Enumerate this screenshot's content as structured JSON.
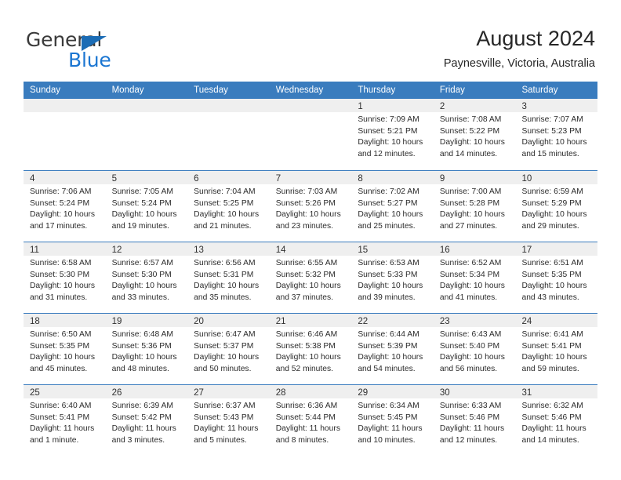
{
  "branding": {
    "name_dark": "General",
    "name_blue": "Blue",
    "triangle_color": "#1b6cb5",
    "blue_color": "#1b76d2"
  },
  "header": {
    "title": "August 2024",
    "subtitle": "Paynesville, Victoria, Australia"
  },
  "theme": {
    "header_bar_color": "#3a7cbe",
    "day_band_color": "#efefef",
    "text_color": "#2b2b2b"
  },
  "weekdays": [
    "Sunday",
    "Monday",
    "Tuesday",
    "Wednesday",
    "Thursday",
    "Friday",
    "Saturday"
  ],
  "weeks": [
    [
      {
        "day": "",
        "empty": true
      },
      {
        "day": "",
        "empty": true
      },
      {
        "day": "",
        "empty": true
      },
      {
        "day": "",
        "empty": true
      },
      {
        "day": "1",
        "sunrise": "Sunrise: 7:09 AM",
        "sunset": "Sunset: 5:21 PM",
        "daylight1": "Daylight: 10 hours",
        "daylight2": "and 12 minutes."
      },
      {
        "day": "2",
        "sunrise": "Sunrise: 7:08 AM",
        "sunset": "Sunset: 5:22 PM",
        "daylight1": "Daylight: 10 hours",
        "daylight2": "and 14 minutes."
      },
      {
        "day": "3",
        "sunrise": "Sunrise: 7:07 AM",
        "sunset": "Sunset: 5:23 PM",
        "daylight1": "Daylight: 10 hours",
        "daylight2": "and 15 minutes."
      }
    ],
    [
      {
        "day": "4",
        "sunrise": "Sunrise: 7:06 AM",
        "sunset": "Sunset: 5:24 PM",
        "daylight1": "Daylight: 10 hours",
        "daylight2": "and 17 minutes."
      },
      {
        "day": "5",
        "sunrise": "Sunrise: 7:05 AM",
        "sunset": "Sunset: 5:24 PM",
        "daylight1": "Daylight: 10 hours",
        "daylight2": "and 19 minutes."
      },
      {
        "day": "6",
        "sunrise": "Sunrise: 7:04 AM",
        "sunset": "Sunset: 5:25 PM",
        "daylight1": "Daylight: 10 hours",
        "daylight2": "and 21 minutes."
      },
      {
        "day": "7",
        "sunrise": "Sunrise: 7:03 AM",
        "sunset": "Sunset: 5:26 PM",
        "daylight1": "Daylight: 10 hours",
        "daylight2": "and 23 minutes."
      },
      {
        "day": "8",
        "sunrise": "Sunrise: 7:02 AM",
        "sunset": "Sunset: 5:27 PM",
        "daylight1": "Daylight: 10 hours",
        "daylight2": "and 25 minutes."
      },
      {
        "day": "9",
        "sunrise": "Sunrise: 7:00 AM",
        "sunset": "Sunset: 5:28 PM",
        "daylight1": "Daylight: 10 hours",
        "daylight2": "and 27 minutes."
      },
      {
        "day": "10",
        "sunrise": "Sunrise: 6:59 AM",
        "sunset": "Sunset: 5:29 PM",
        "daylight1": "Daylight: 10 hours",
        "daylight2": "and 29 minutes."
      }
    ],
    [
      {
        "day": "11",
        "sunrise": "Sunrise: 6:58 AM",
        "sunset": "Sunset: 5:30 PM",
        "daylight1": "Daylight: 10 hours",
        "daylight2": "and 31 minutes."
      },
      {
        "day": "12",
        "sunrise": "Sunrise: 6:57 AM",
        "sunset": "Sunset: 5:30 PM",
        "daylight1": "Daylight: 10 hours",
        "daylight2": "and 33 minutes."
      },
      {
        "day": "13",
        "sunrise": "Sunrise: 6:56 AM",
        "sunset": "Sunset: 5:31 PM",
        "daylight1": "Daylight: 10 hours",
        "daylight2": "and 35 minutes."
      },
      {
        "day": "14",
        "sunrise": "Sunrise: 6:55 AM",
        "sunset": "Sunset: 5:32 PM",
        "daylight1": "Daylight: 10 hours",
        "daylight2": "and 37 minutes."
      },
      {
        "day": "15",
        "sunrise": "Sunrise: 6:53 AM",
        "sunset": "Sunset: 5:33 PM",
        "daylight1": "Daylight: 10 hours",
        "daylight2": "and 39 minutes."
      },
      {
        "day": "16",
        "sunrise": "Sunrise: 6:52 AM",
        "sunset": "Sunset: 5:34 PM",
        "daylight1": "Daylight: 10 hours",
        "daylight2": "and 41 minutes."
      },
      {
        "day": "17",
        "sunrise": "Sunrise: 6:51 AM",
        "sunset": "Sunset: 5:35 PM",
        "daylight1": "Daylight: 10 hours",
        "daylight2": "and 43 minutes."
      }
    ],
    [
      {
        "day": "18",
        "sunrise": "Sunrise: 6:50 AM",
        "sunset": "Sunset: 5:35 PM",
        "daylight1": "Daylight: 10 hours",
        "daylight2": "and 45 minutes."
      },
      {
        "day": "19",
        "sunrise": "Sunrise: 6:48 AM",
        "sunset": "Sunset: 5:36 PM",
        "daylight1": "Daylight: 10 hours",
        "daylight2": "and 48 minutes."
      },
      {
        "day": "20",
        "sunrise": "Sunrise: 6:47 AM",
        "sunset": "Sunset: 5:37 PM",
        "daylight1": "Daylight: 10 hours",
        "daylight2": "and 50 minutes."
      },
      {
        "day": "21",
        "sunrise": "Sunrise: 6:46 AM",
        "sunset": "Sunset: 5:38 PM",
        "daylight1": "Daylight: 10 hours",
        "daylight2": "and 52 minutes."
      },
      {
        "day": "22",
        "sunrise": "Sunrise: 6:44 AM",
        "sunset": "Sunset: 5:39 PM",
        "daylight1": "Daylight: 10 hours",
        "daylight2": "and 54 minutes."
      },
      {
        "day": "23",
        "sunrise": "Sunrise: 6:43 AM",
        "sunset": "Sunset: 5:40 PM",
        "daylight1": "Daylight: 10 hours",
        "daylight2": "and 56 minutes."
      },
      {
        "day": "24",
        "sunrise": "Sunrise: 6:41 AM",
        "sunset": "Sunset: 5:41 PM",
        "daylight1": "Daylight: 10 hours",
        "daylight2": "and 59 minutes."
      }
    ],
    [
      {
        "day": "25",
        "sunrise": "Sunrise: 6:40 AM",
        "sunset": "Sunset: 5:41 PM",
        "daylight1": "Daylight: 11 hours",
        "daylight2": "and 1 minute."
      },
      {
        "day": "26",
        "sunrise": "Sunrise: 6:39 AM",
        "sunset": "Sunset: 5:42 PM",
        "daylight1": "Daylight: 11 hours",
        "daylight2": "and 3 minutes."
      },
      {
        "day": "27",
        "sunrise": "Sunrise: 6:37 AM",
        "sunset": "Sunset: 5:43 PM",
        "daylight1": "Daylight: 11 hours",
        "daylight2": "and 5 minutes."
      },
      {
        "day": "28",
        "sunrise": "Sunrise: 6:36 AM",
        "sunset": "Sunset: 5:44 PM",
        "daylight1": "Daylight: 11 hours",
        "daylight2": "and 8 minutes."
      },
      {
        "day": "29",
        "sunrise": "Sunrise: 6:34 AM",
        "sunset": "Sunset: 5:45 PM",
        "daylight1": "Daylight: 11 hours",
        "daylight2": "and 10 minutes."
      },
      {
        "day": "30",
        "sunrise": "Sunrise: 6:33 AM",
        "sunset": "Sunset: 5:46 PM",
        "daylight1": "Daylight: 11 hours",
        "daylight2": "and 12 minutes."
      },
      {
        "day": "31",
        "sunrise": "Sunrise: 6:32 AM",
        "sunset": "Sunset: 5:46 PM",
        "daylight1": "Daylight: 11 hours",
        "daylight2": "and 14 minutes."
      }
    ]
  ]
}
